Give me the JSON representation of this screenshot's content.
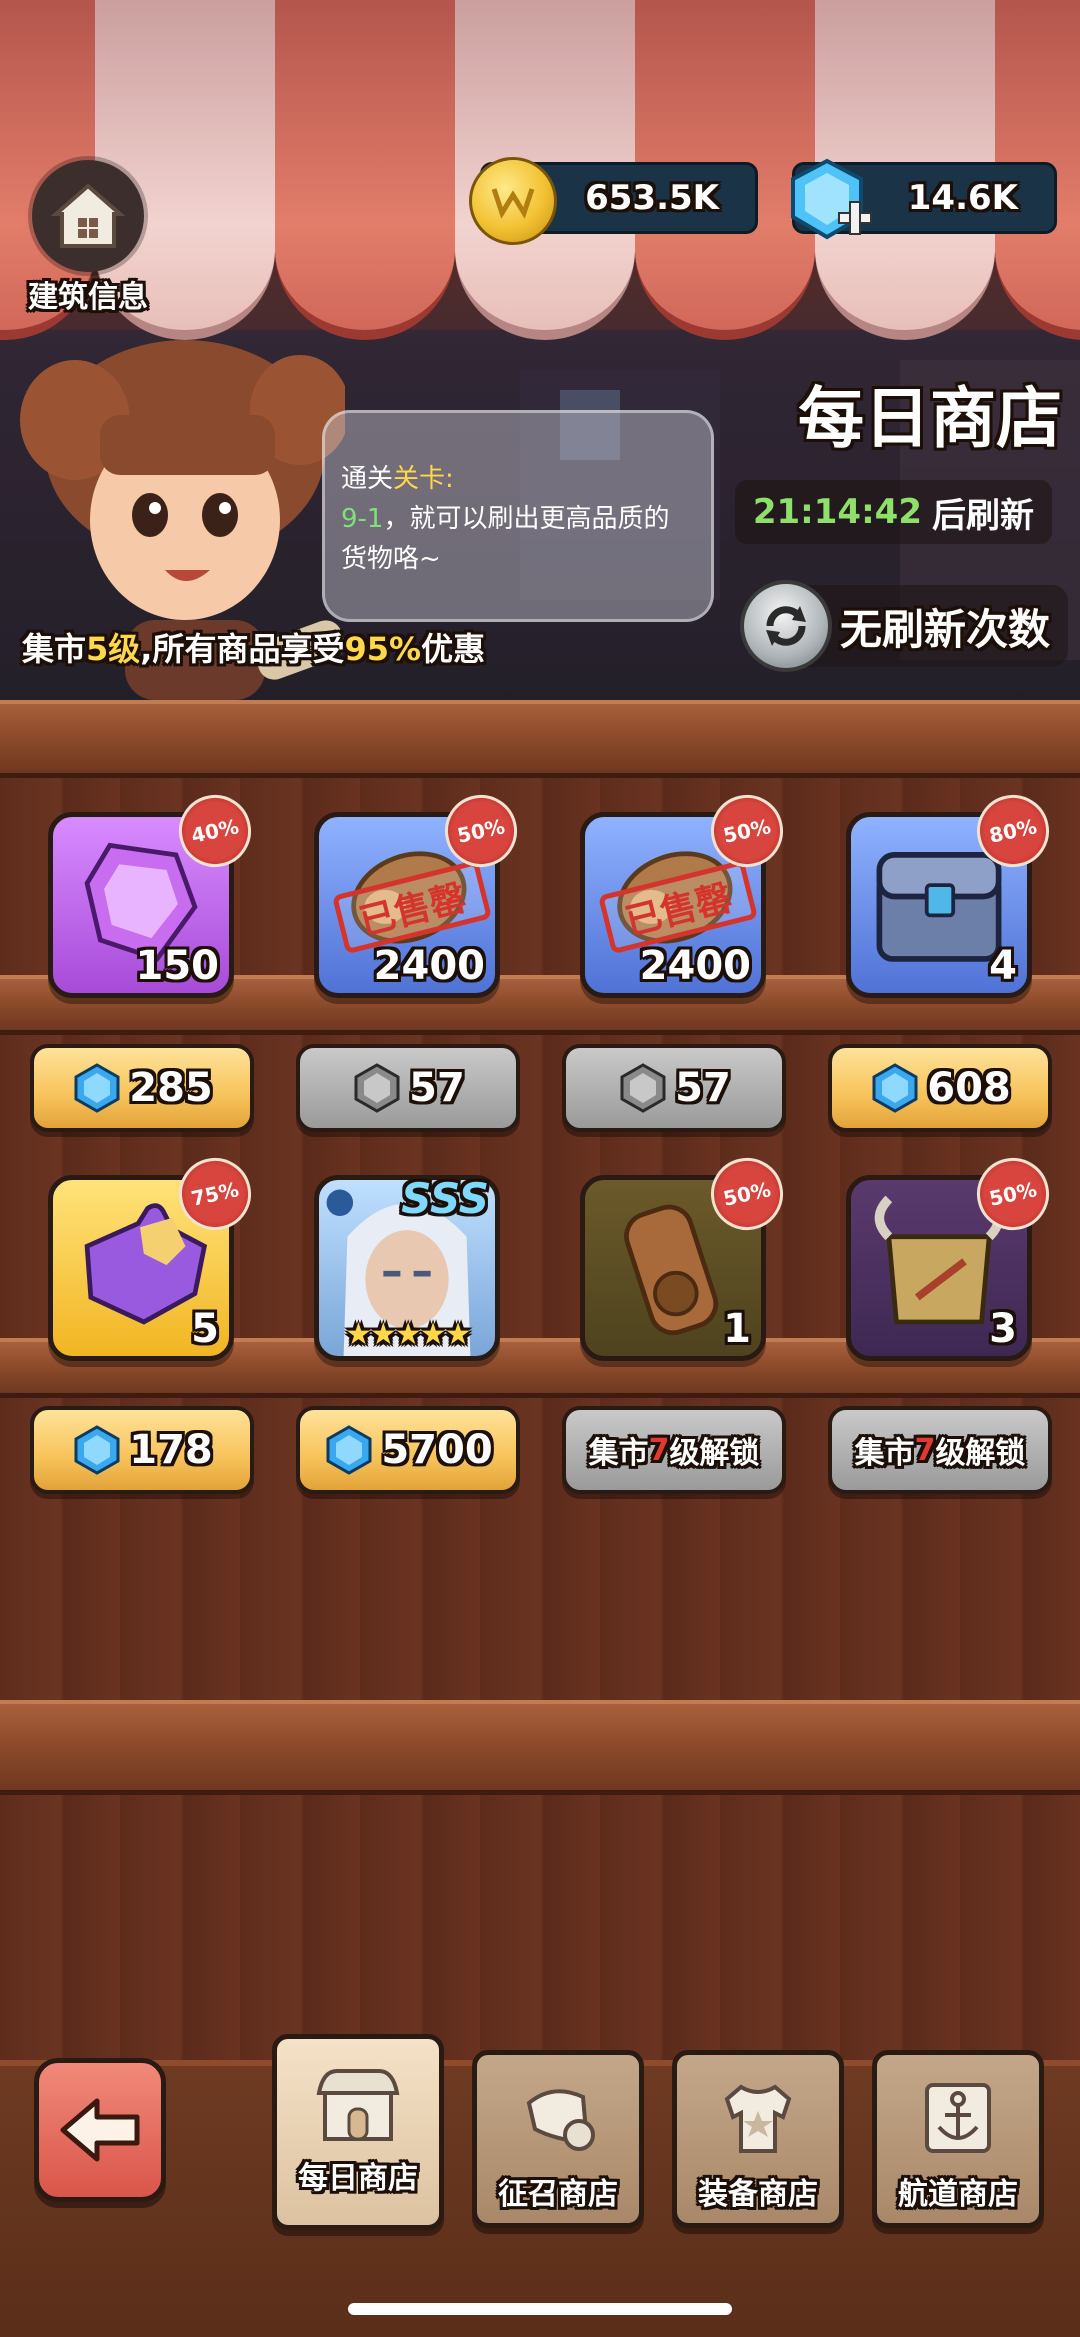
{
  "header": {
    "building_info_label": "建筑信息",
    "gold_amount": "653.5K",
    "gem_amount": "14.6K"
  },
  "banner": {
    "shop_title": "每日商店",
    "timer_value": "21:14:42",
    "timer_suffix": "后刷新",
    "refresh_label": "无刷新次数",
    "bubble_line1_a": "通关",
    "bubble_line1_b": "关卡:",
    "bubble_line2_a": "9-1",
    "bubble_line2_b": "，就可以刷出更高品质的",
    "bubble_line3": "货物咯~",
    "market_a": "集市",
    "market_level": "5级",
    "market_b": ",所有商品享受",
    "market_pct": "95%",
    "market_c": "优惠"
  },
  "items": [
    {
      "name": "purple-gem",
      "quantity": "150",
      "discount": "40%",
      "price": "285",
      "price_style": "gold",
      "currency": "blue-gem-icon"
    },
    {
      "name": "wood-log-sold",
      "quantity": "2400",
      "discount": "50%",
      "sold_label": "已售罄",
      "price": "57",
      "price_style": "gray",
      "currency": "gray-gem-icon"
    },
    {
      "name": "wood-log-sold-2",
      "quantity": "2400",
      "discount": "50%",
      "sold_label": "已售罄",
      "price": "57",
      "price_style": "gray",
      "currency": "gray-gem-icon"
    },
    {
      "name": "treasure-chest",
      "quantity": "4",
      "discount": "80%",
      "price": "608",
      "price_style": "gold",
      "currency": "blue-gem-icon"
    },
    {
      "name": "puzzle-piece",
      "quantity": "5",
      "discount": "75%",
      "price": "178",
      "price_style": "gold",
      "currency": "blue-gem-icon"
    },
    {
      "name": "hero-card",
      "rank": "SSS",
      "stars": 5,
      "price": "5700",
      "price_style": "gold",
      "currency": "blue-gem-icon"
    },
    {
      "name": "scroll",
      "quantity": "1",
      "discount": "50%",
      "lock_a": "集市",
      "lock_level": "7",
      "lock_b": "级解锁"
    },
    {
      "name": "horned-scroll",
      "quantity": "3",
      "discount": "50%",
      "lock_a": "集市",
      "lock_level": "7",
      "lock_b": "级解锁"
    }
  ],
  "nav": {
    "tabs": [
      {
        "label": "每日商店",
        "active": true
      },
      {
        "label": "征召商店",
        "active": false
      },
      {
        "label": "装备商店",
        "active": false
      },
      {
        "label": "航道商店",
        "active": false
      }
    ]
  },
  "colors": {
    "highlight_yellow": "#ffd84a",
    "timer_green": "#8fe06a",
    "lock_red": "#e03a2e",
    "discount_red": "#d8453e"
  }
}
